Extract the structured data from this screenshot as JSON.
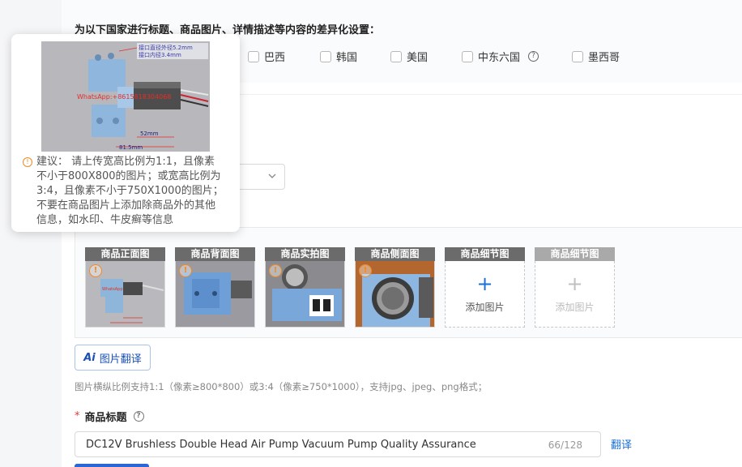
{
  "country_section": {
    "title": "为以下国家进行标题、商品图片、详情描述等内容的差异化设置：",
    "countries": [
      {
        "label": "巴西",
        "checked": false
      },
      {
        "label": "韩国",
        "checked": false
      },
      {
        "label": "美国",
        "checked": false
      },
      {
        "label": "中东六国",
        "checked": false,
        "has_help": true
      },
      {
        "label": "墨西哥",
        "checked": false
      }
    ]
  },
  "popover": {
    "image_annotations": [
      "接口直径外径5.2mm",
      "接口内径3.4mm",
      "WhatsApp:+8615818304068",
      "52mm",
      "81.5mm"
    ],
    "tip_lines": [
      "建议：  请上传宽高比例为1:1，且像素",
      "不小于800X800的图片；或宽高比例为",
      "3:4，且像素不小于750X1000的图片；",
      "不要在商品图片上添加除商品外的其他",
      "信息，如水印、牛皮癣等信息"
    ]
  },
  "image_slots": [
    {
      "label": "商品正面图",
      "filled": true
    },
    {
      "label": "商品背面图",
      "filled": true
    },
    {
      "label": "商品实拍图",
      "filled": true
    },
    {
      "label": "商品侧面图",
      "filled": true
    },
    {
      "label": "商品细节图",
      "filled": false,
      "add_label": "添加图片",
      "disabled": false
    },
    {
      "label": "商品细节图",
      "filled": false,
      "add_label": "添加图片",
      "disabled": true
    }
  ],
  "ai_translate_label": "图片翻译",
  "image_hint": "图片横纵比例支持1:1（像素≥800*800）或3:4（像素≥750*1000），支持jpg、jpeg、png格式；",
  "product_title": {
    "label": "商品标题",
    "value": "DC12V Brushless Double Head Air Pump Vacuum Pump Quality Assurance",
    "count": "66/128",
    "translate_label": "翻译"
  },
  "colors": {
    "accent": "#1a6fd8",
    "warning": "#f08a24",
    "required": "#e03a3a"
  }
}
